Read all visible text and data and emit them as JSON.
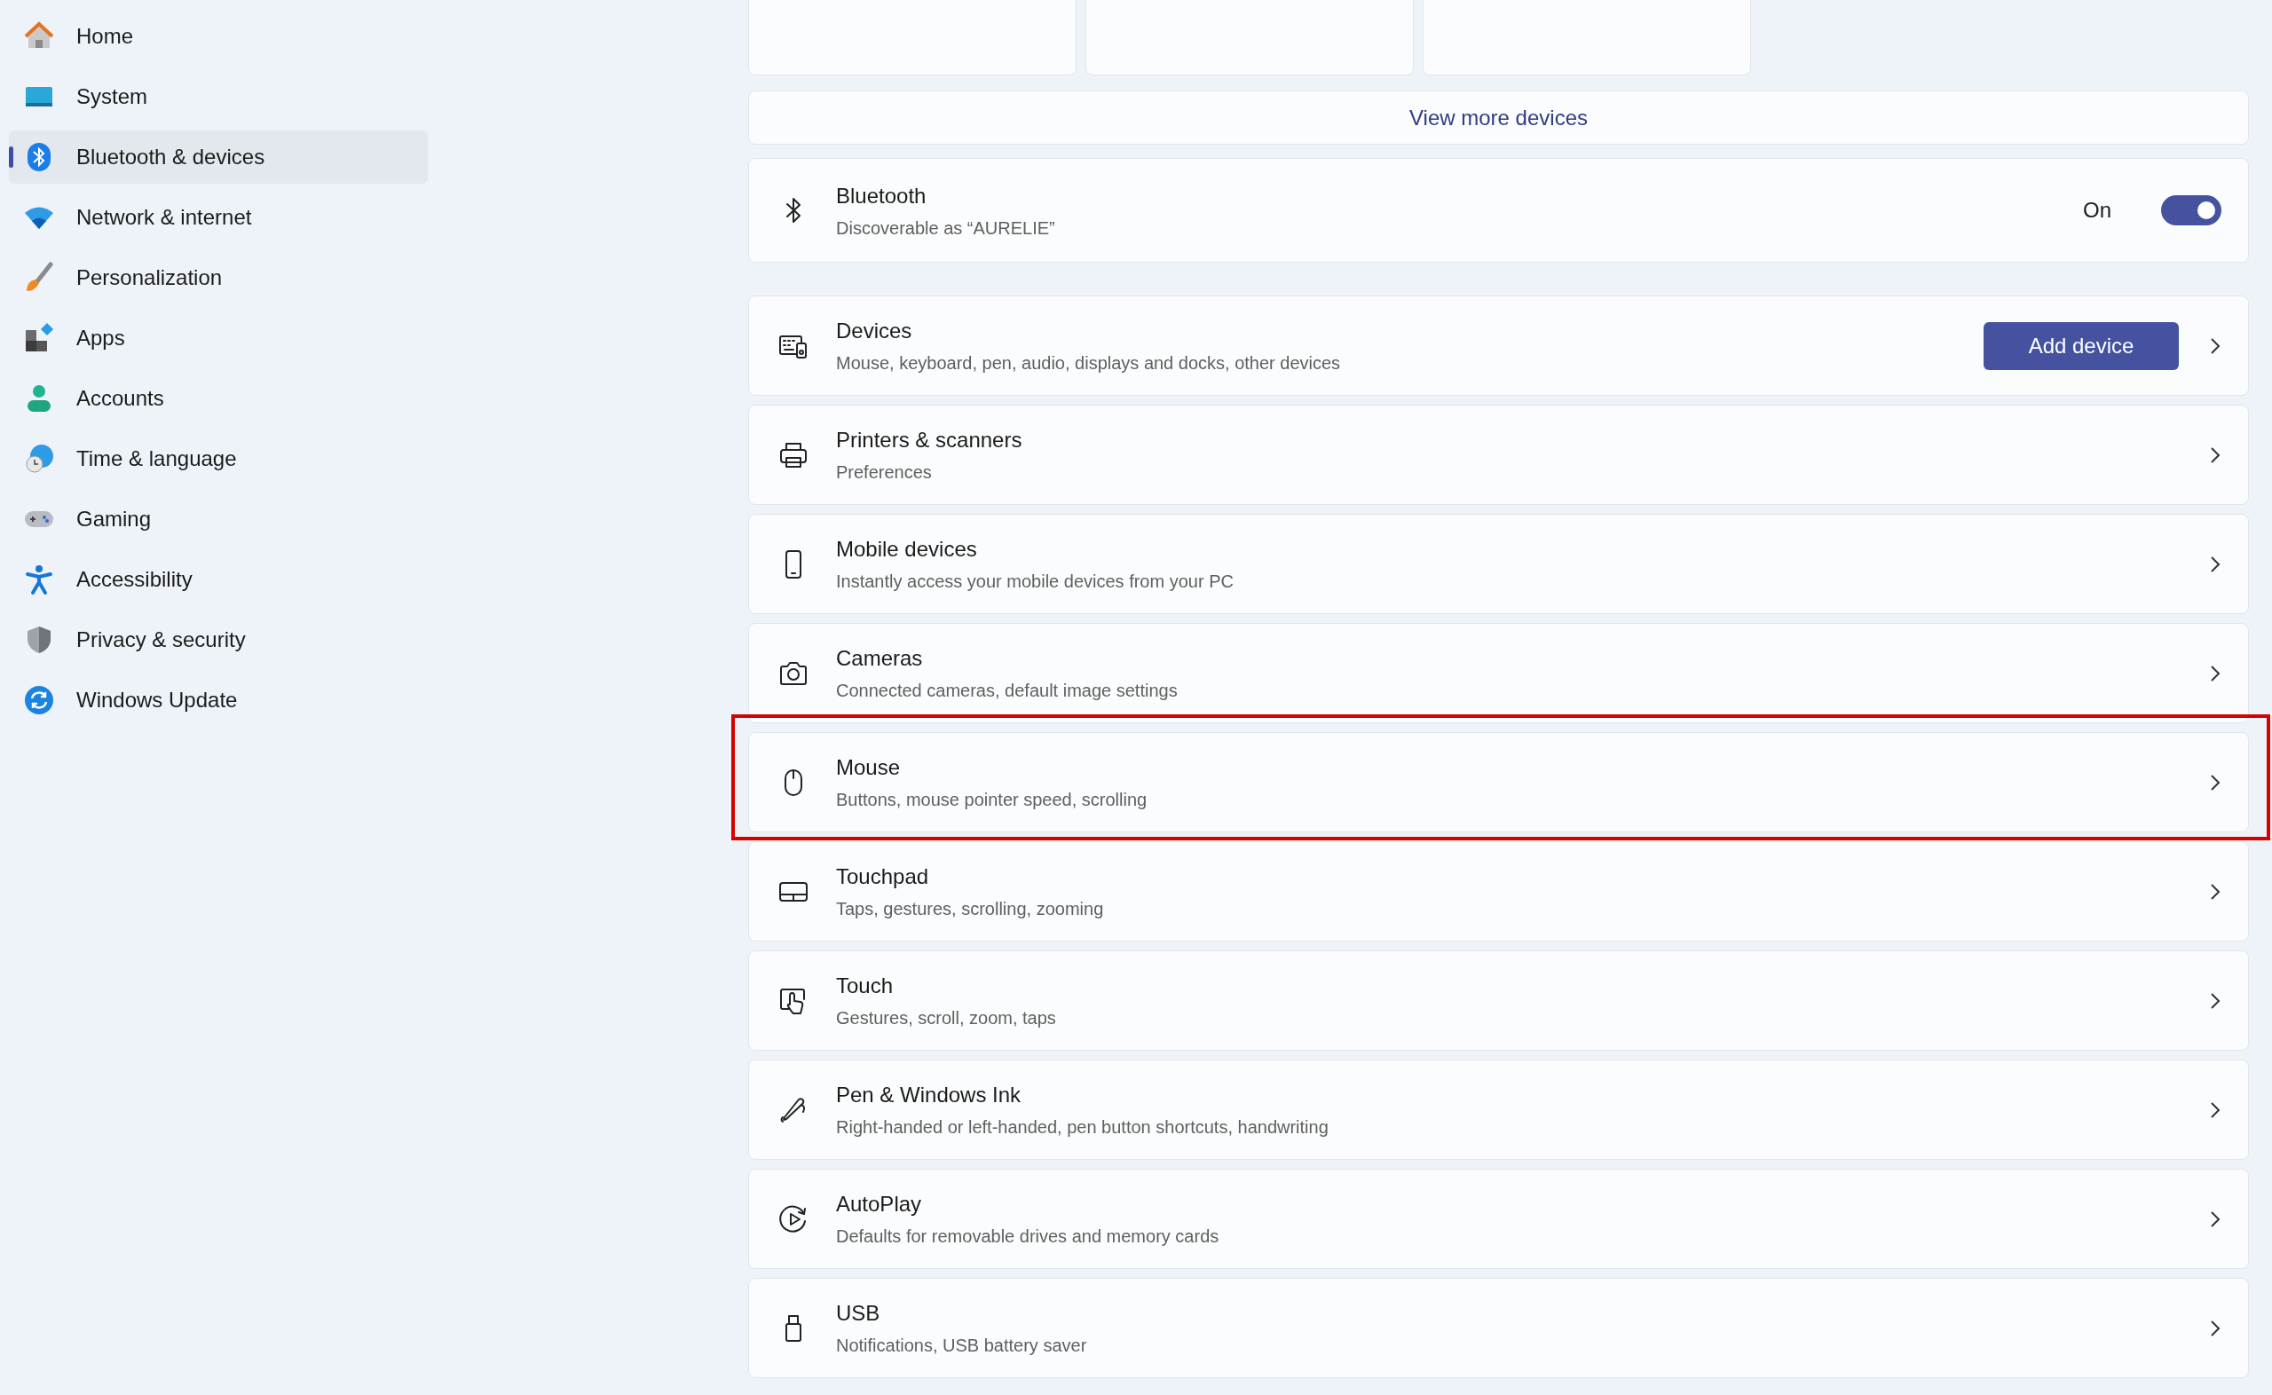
{
  "sidebar": {
    "items": [
      {
        "label": "Home",
        "selected": false
      },
      {
        "label": "System",
        "selected": false
      },
      {
        "label": "Bluetooth & devices",
        "selected": true
      },
      {
        "label": "Network & internet",
        "selected": false
      },
      {
        "label": "Personalization",
        "selected": false
      },
      {
        "label": "Apps",
        "selected": false
      },
      {
        "label": "Accounts",
        "selected": false
      },
      {
        "label": "Time & language",
        "selected": false
      },
      {
        "label": "Gaming",
        "selected": false
      },
      {
        "label": "Accessibility",
        "selected": false
      },
      {
        "label": "Privacy & security",
        "selected": false
      },
      {
        "label": "Windows Update",
        "selected": false
      }
    ]
  },
  "view_more": {
    "label": "View more devices"
  },
  "bluetooth": {
    "title": "Bluetooth",
    "subtitle": "Discoverable as “AURELIE”",
    "state_label": "On",
    "on": true
  },
  "rows": [
    {
      "title": "Devices",
      "subtitle": "Mouse, keyboard, pen, audio, displays and docks, other devices",
      "button": "Add device",
      "highlighted": false
    },
    {
      "title": "Printers & scanners",
      "subtitle": "Preferences",
      "highlighted": false
    },
    {
      "title": "Mobile devices",
      "subtitle": "Instantly access your mobile devices from your PC",
      "highlighted": false
    },
    {
      "title": "Cameras",
      "subtitle": "Connected cameras, default image settings",
      "highlighted": false
    },
    {
      "title": "Mouse",
      "subtitle": "Buttons, mouse pointer speed, scrolling",
      "highlighted": true
    },
    {
      "title": "Touchpad",
      "subtitle": "Taps, gestures, scrolling, zooming",
      "highlighted": false
    },
    {
      "title": "Touch",
      "subtitle": "Gestures, scroll, zoom, taps",
      "highlighted": false
    },
    {
      "title": "Pen & Windows Ink",
      "subtitle": "Right-handed or left-handed, pen button shortcuts, handwriting",
      "highlighted": false
    },
    {
      "title": "AutoPlay",
      "subtitle": "Defaults for removable drives and memory cards",
      "highlighted": false
    },
    {
      "title": "USB",
      "subtitle": "Notifications, USB battery saver",
      "highlighted": false
    }
  ]
}
